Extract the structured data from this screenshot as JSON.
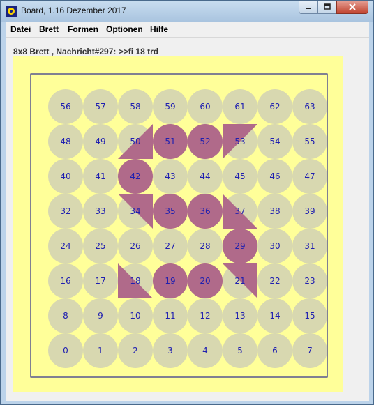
{
  "window": {
    "title": "Board, 1.16 Dezember 2017"
  },
  "menu": [
    "Datei",
    "Brett",
    "Formen",
    "Optionen",
    "Hilfe"
  ],
  "status": "8x8 Brett , Nachricht#297: >>fi 18 trd",
  "colors": {
    "board_bg": "#ffff99",
    "frame": "#00008b",
    "empty_cell": "#d8d8b0",
    "filled": "#b06a8a",
    "label": "#2020b0"
  },
  "board": {
    "rows": 8,
    "cols": 8,
    "labels": [
      [
        "56",
        "57",
        "58",
        "59",
        "60",
        "61",
        "62",
        "63"
      ],
      [
        "48",
        "49",
        "50",
        "51",
        "52",
        "53",
        "54",
        "55"
      ],
      [
        "40",
        "41",
        "42",
        "43",
        "44",
        "45",
        "46",
        "47"
      ],
      [
        "32",
        "33",
        "34",
        "35",
        "36",
        "37",
        "38",
        "39"
      ],
      [
        "24",
        "25",
        "26",
        "27",
        "28",
        "29",
        "30",
        "31"
      ],
      [
        "16",
        "17",
        "18",
        "19",
        "20",
        "21",
        "22",
        "23"
      ],
      [
        "8",
        "9",
        "10",
        "11",
        "12",
        "13",
        "14",
        "15"
      ],
      [
        "0",
        "1",
        "2",
        "3",
        "4",
        "5",
        "6",
        "7"
      ]
    ],
    "shapes": {
      "circle": [
        "51",
        "52",
        "42",
        "35",
        "36",
        "29",
        "19",
        "20"
      ],
      "triangle-ur": [
        "50"
      ],
      "triangle-ul": [
        "53"
      ],
      "triangle-ll": [
        "34",
        "21"
      ],
      "triangle-lr": [
        "37",
        "18"
      ]
    }
  }
}
